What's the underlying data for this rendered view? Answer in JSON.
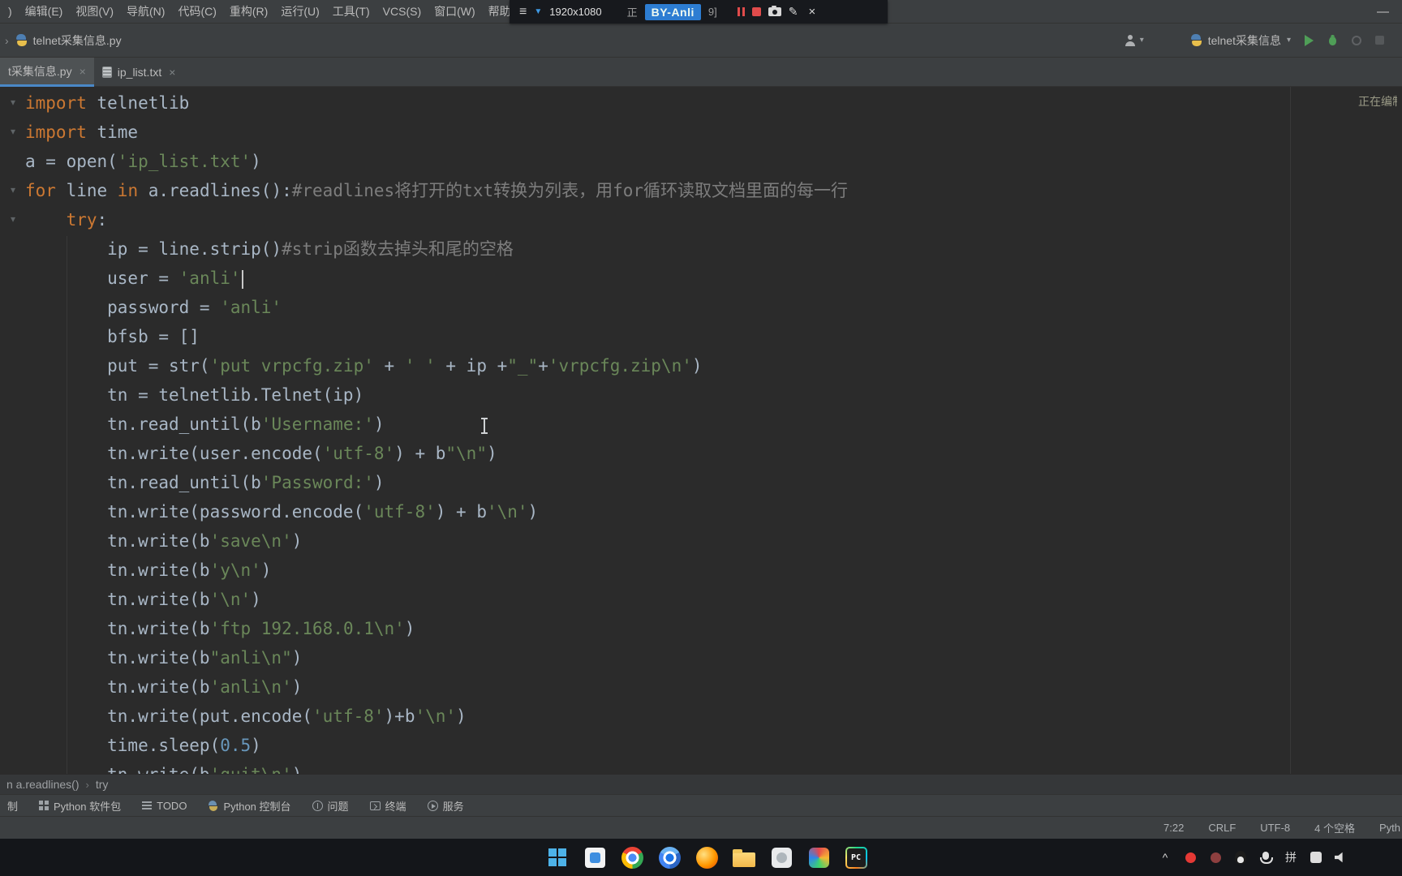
{
  "glyphs": {
    "dropdown": "▾",
    "chevron": "›",
    "fold": "▾",
    "separator": "›"
  },
  "colors": {
    "accent_blue": "#4a88c7",
    "keyword": "#cc7832",
    "string": "#6a8759",
    "comment": "#7d7d7d",
    "number": "#6897bb",
    "editor_text": "#a9b7c6",
    "run_green": "#4f9e57",
    "record_red": "#e04b4b"
  },
  "menubar": {
    "items": [
      ")",
      "编辑(E)",
      "视图(V)",
      "导航(N)",
      "代码(C)",
      "重构(R)",
      "运行(U)",
      "工具(T)",
      "VCS(S)",
      "窗口(W)",
      "帮助"
    ],
    "minimize_glyph": "—"
  },
  "recorder": {
    "menu_glyph": "≡",
    "pin_glyph": "▼",
    "resolution": "1920x1080",
    "left_partial": "正",
    "watermark": "BY-Anli",
    "after_text": "9]",
    "pencil_glyph": "✎",
    "close_glyph": "×"
  },
  "navbar": {
    "file_name": "telnet采集信息.py",
    "run_config": "telnet采集信息"
  },
  "tabs": [
    {
      "label": "t采集信息.py",
      "close": "×",
      "selected": true,
      "icon": null
    },
    {
      "label": "ip_list.txt",
      "close": "×",
      "selected": false,
      "icon": "txt"
    }
  ],
  "editor": {
    "indexing_text": "正在编制",
    "fold_lines": [
      0,
      1,
      3,
      4
    ],
    "lines": [
      [
        [
          "kw",
          "import"
        ],
        [
          "pl",
          " telnetlib"
        ]
      ],
      [
        [
          "kw",
          "import"
        ],
        [
          "pl",
          " time"
        ]
      ],
      [
        [
          "pl",
          "a = open("
        ],
        [
          "str",
          "'ip_list.txt'"
        ],
        [
          "pl",
          ")"
        ]
      ],
      [
        [
          "kw",
          "for"
        ],
        [
          "pl",
          " line "
        ],
        [
          "kw",
          "in"
        ],
        [
          "pl",
          " a.readlines():"
        ],
        [
          "cm",
          "#readlines将打开的txt转换为列表，用for循环读取文档里面的每一行"
        ]
      ],
      [
        [
          "pl",
          "    "
        ],
        [
          "kw",
          "try"
        ],
        [
          "pl",
          ":"
        ]
      ],
      [
        [
          "pl",
          "        ip = line.strip()"
        ],
        [
          "cm",
          "#strip函数去掉头和尾的空格"
        ]
      ],
      [
        [
          "pl",
          "        user = "
        ],
        [
          "str",
          "'anli'"
        ],
        [
          "caret",
          ""
        ]
      ],
      [
        [
          "pl",
          "        password = "
        ],
        [
          "str",
          "'anli'"
        ]
      ],
      [
        [
          "pl",
          "        bfsb = []"
        ]
      ],
      [
        [
          "pl",
          "        put = str("
        ],
        [
          "str",
          "'put vrpcfg.zip'"
        ],
        [
          "pl",
          " + "
        ],
        [
          "str",
          "' '"
        ],
        [
          "pl",
          " + ip +"
        ],
        [
          "str",
          "\"_\""
        ],
        [
          "pl",
          "+"
        ],
        [
          "str",
          "'vrpcfg.zip\\n'"
        ],
        [
          "pl",
          ")"
        ]
      ],
      [
        [
          "pl",
          "        tn = telnetlib.Telnet(ip)"
        ]
      ],
      [
        [
          "pl",
          "        tn.read_until(b"
        ],
        [
          "str",
          "'Username:'"
        ],
        [
          "pl",
          ")"
        ]
      ],
      [
        [
          "pl",
          "        tn.write(user.encode("
        ],
        [
          "str",
          "'utf-8'"
        ],
        [
          "pl",
          ") + b"
        ],
        [
          "str",
          "\"\\n\""
        ],
        [
          "pl",
          ")"
        ]
      ],
      [
        [
          "pl",
          "        tn.read_until(b"
        ],
        [
          "str",
          "'Password:'"
        ],
        [
          "pl",
          ")"
        ]
      ],
      [
        [
          "pl",
          "        tn.write(password.encode("
        ],
        [
          "str",
          "'utf-8'"
        ],
        [
          "pl",
          ") + b"
        ],
        [
          "str",
          "'\\n'"
        ],
        [
          "pl",
          ")"
        ]
      ],
      [
        [
          "pl",
          "        tn.write(b"
        ],
        [
          "str",
          "'save\\n'"
        ],
        [
          "pl",
          ")"
        ]
      ],
      [
        [
          "pl",
          "        tn.write(b"
        ],
        [
          "str",
          "'y\\n'"
        ],
        [
          "pl",
          ")"
        ]
      ],
      [
        [
          "pl",
          "        tn.write(b"
        ],
        [
          "str",
          "'\\n'"
        ],
        [
          "pl",
          ")"
        ]
      ],
      [
        [
          "pl",
          "        tn.write(b"
        ],
        [
          "str",
          "'ftp 192.168.0.1\\n'"
        ],
        [
          "pl",
          ")"
        ]
      ],
      [
        [
          "pl",
          "        tn.write(b"
        ],
        [
          "str",
          "\"anli\\n\""
        ],
        [
          "pl",
          ")"
        ]
      ],
      [
        [
          "pl",
          "        tn.write(b"
        ],
        [
          "str",
          "'anli\\n'"
        ],
        [
          "pl",
          ")"
        ]
      ],
      [
        [
          "pl",
          "        tn.write(put.encode("
        ],
        [
          "str",
          "'utf-8'"
        ],
        [
          "pl",
          ")+b"
        ],
        [
          "str",
          "'\\n'"
        ],
        [
          "pl",
          ")"
        ]
      ],
      [
        [
          "pl",
          "        time.sleep("
        ],
        [
          "num",
          "0.5"
        ],
        [
          "pl",
          ")"
        ]
      ],
      [
        [
          "pl",
          "        tn.write(b"
        ],
        [
          "str",
          "'quit\\n'"
        ],
        [
          "pl",
          ")"
        ]
      ]
    ]
  },
  "breadcrumbs": {
    "items": [
      "n a.readlines()",
      "try"
    ]
  },
  "tool_windows": [
    {
      "id": "version-control",
      "label": "制",
      "icon": null
    },
    {
      "id": "python-packages",
      "label": "Python 软件包",
      "icon": "pkg"
    },
    {
      "id": "todo",
      "label": "TODO",
      "icon": "todo"
    },
    {
      "id": "python-console",
      "label": "Python 控制台",
      "icon": "pycon"
    },
    {
      "id": "problems",
      "label": "问题",
      "icon": "warn"
    },
    {
      "id": "terminal",
      "label": "终端",
      "icon": "term"
    },
    {
      "id": "services",
      "label": "服务",
      "icon": "serv"
    }
  ],
  "statusbar": {
    "items": [
      {
        "id": "caret-position",
        "label": "7:22"
      },
      {
        "id": "line-separator",
        "label": "CRLF"
      },
      {
        "id": "file-encoding",
        "label": "UTF-8"
      },
      {
        "id": "indent-style",
        "label": "4 个空格"
      },
      {
        "id": "interpreter",
        "label": "Pyth"
      }
    ]
  },
  "taskbar": {
    "icons": [
      {
        "id": "start-button",
        "shape": "winlogo"
      },
      {
        "id": "taskbar-save-app-icon",
        "shape": "everything"
      },
      {
        "id": "taskbar-chrome-icon",
        "shape": "chrome"
      },
      {
        "id": "taskbar-chromium-icon",
        "shape": "chrome2"
      },
      {
        "id": "taskbar-firefox-icon",
        "shape": "firefox"
      },
      {
        "id": "taskbar-explorer-icon",
        "shape": "folder"
      },
      {
        "id": "taskbar-app-icon-1",
        "shape": "applight"
      },
      {
        "id": "taskbar-app-icon-2",
        "shape": "pinwheel"
      },
      {
        "id": "taskbar-pycharm-icon",
        "shape": "pycharm",
        "label": "PC"
      }
    ],
    "tray": [
      {
        "id": "tray-expand-icon",
        "shape": "text",
        "glyph": "^"
      },
      {
        "id": "tray-record-icon",
        "shape": "dotred"
      },
      {
        "id": "tray-app-dot-icon",
        "shape": "dotmaroon"
      },
      {
        "id": "tray-penguin-icon",
        "shape": "penguin"
      },
      {
        "id": "tray-mic-icon",
        "shape": "mic"
      },
      {
        "id": "ime-pinyin-indicator",
        "shape": "text",
        "glyph": "拼"
      },
      {
        "id": "tray-chip-icon",
        "shape": "chip"
      },
      {
        "id": "tray-speaker-icon",
        "shape": "speaker"
      }
    ]
  }
}
